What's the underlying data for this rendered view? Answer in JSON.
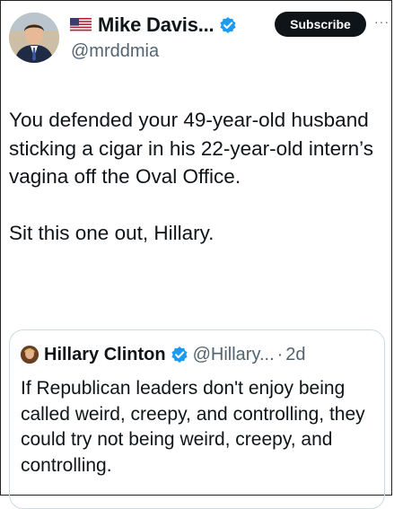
{
  "author": {
    "name": "Mike Davis...",
    "handle": "@mrddmia",
    "flag_icon": "us-flag-icon",
    "verified_icon": "verified-badge-icon"
  },
  "actions": {
    "subscribe_label": "Subscribe",
    "more_label": "···"
  },
  "post": {
    "paragraphs": [
      "You defended your 49-year-old husband sticking a cigar in his 22-year-old intern’s vagina off the Oval Office.",
      "Sit this one out, Hillary."
    ]
  },
  "quoted_post": {
    "name": "Hillary Clinton",
    "handle": "@Hillary...",
    "separator": "·",
    "time": "2d",
    "text": "If Republican leaders don't enjoy being called weird, creepy, and controlling, they could try not being weird, creepy, and controlling."
  },
  "colors": {
    "text": "#0f1419",
    "secondary": "#536471",
    "verified": "#1d9bf0",
    "subscribe_bg": "#0f1419",
    "border": "#cfd9de"
  }
}
